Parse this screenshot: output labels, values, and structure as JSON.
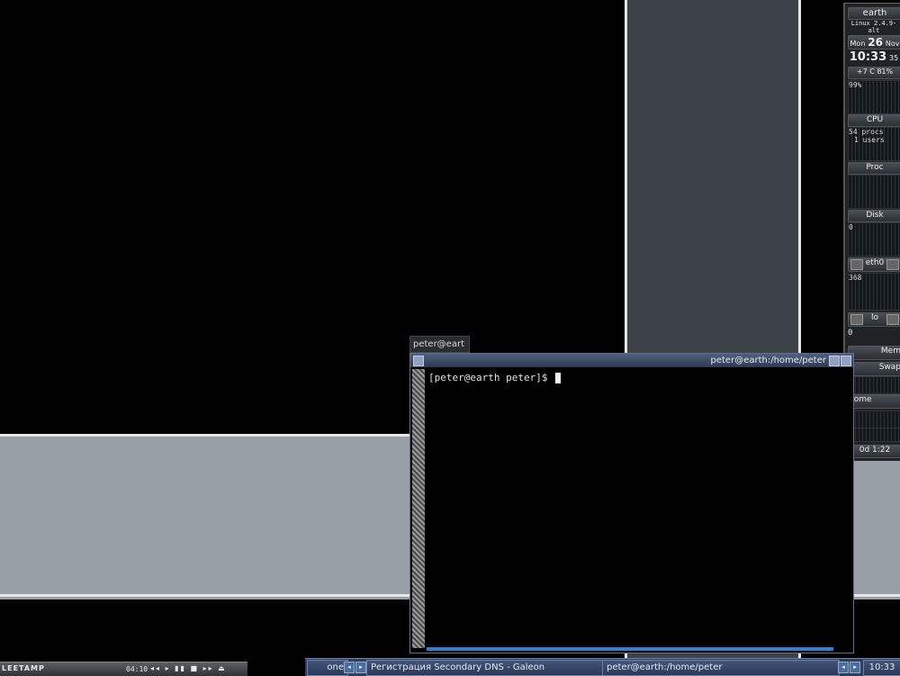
{
  "gkrellm": {
    "hostname": "earth",
    "system": "Linux 2.4.9-alt",
    "date": {
      "weekday": "Mon",
      "day": "26",
      "month": "Nov"
    },
    "clock": {
      "time": "10:33",
      "seconds": "35"
    },
    "sensors": "+7  C  81%",
    "cpu": {
      "percent": "99%",
      "label": "CPU"
    },
    "proc": {
      "procs": "54 procs",
      "users": "1 users",
      "label": "Proc"
    },
    "disk": {
      "label": "Disk",
      "value": "0"
    },
    "eth0": {
      "label": "eth0",
      "value": "368"
    },
    "lo": {
      "label": "lo",
      "value": "0"
    },
    "mem_label": "Mem",
    "swap_label": "Swap",
    "fs_label": "home",
    "uptime": "0d  1:22"
  },
  "terminal": {
    "tab_title": "peter@eart",
    "window_title": "peter@earth:/home/peter",
    "prompt": "[peter@earth peter]$"
  },
  "xmms": {
    "logo": "LEETAMP",
    "time": "04:10"
  },
  "taskbar": {
    "desktop": "one",
    "windows": [
      {
        "label": "Регистрация Secondary DNS - Galeon"
      },
      {
        "label": "peter@earth:/home/peter"
      }
    ],
    "clock": "10:33"
  }
}
